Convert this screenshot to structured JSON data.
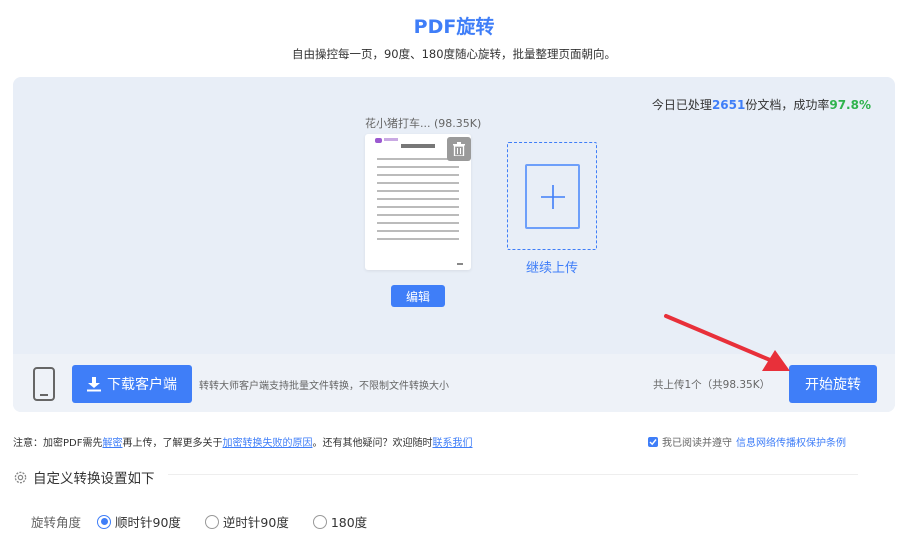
{
  "header": {
    "title": "PDF旋转",
    "subtitle": "自由操控每一页，90度、180度随心旋转，批量整理页面朝向。"
  },
  "stats": {
    "prefix": "今日已处理",
    "count": "2651",
    "middle": "份文档，成功率",
    "rate": "97.8%"
  },
  "file": {
    "name": "花小猪打车...",
    "size": "(98.35K)",
    "edit_label": "编辑"
  },
  "upload_more": {
    "label": "继续上传"
  },
  "bottom_bar": {
    "download_label": "下载客户端",
    "download_desc": "转转大师客户端支持批量文件转换，不限制文件转换大小",
    "upload_count": "共上传1个（共98.35K）",
    "start_label": "开始旋转"
  },
  "notice": {
    "p1": "注意：加密PDF需先",
    "link1": "解密",
    "p2": "再上传，了解更多关于",
    "link2": "加密转换失败的原因",
    "p3": "。还有其他疑问？欢迎随时",
    "link3": "联系我们"
  },
  "agree": {
    "pre": "我已阅读并遵守",
    "link": "信息网络传播权保护条例"
  },
  "settings": {
    "title": "自定义转换设置如下"
  },
  "rotation": {
    "label": "旋转角度",
    "options": [
      "顺时针90度",
      "逆时针90度",
      "180度"
    ],
    "selected": "顺时针90度"
  },
  "colors": {
    "accent": "#3f7ef8",
    "success": "#2fb34d",
    "arrow": "#e8303a"
  }
}
